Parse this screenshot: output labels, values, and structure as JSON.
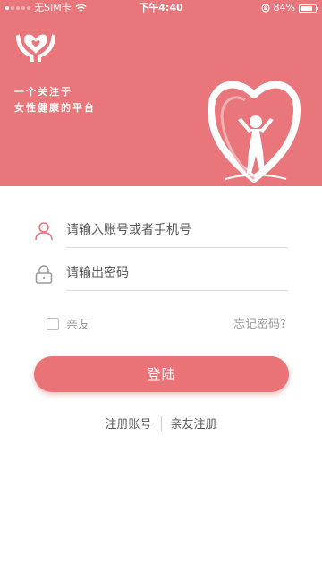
{
  "status_bar": {
    "carrier": "无SIM卡",
    "time": "下午4:40",
    "battery_percent_label": "84%",
    "battery_level": 0.84
  },
  "header": {
    "slogan_line1": "一个关注于",
    "slogan_line2": "女性健康的平台"
  },
  "form": {
    "account_placeholder": "请输入账号或者手机号",
    "password_placeholder": "请输出密码",
    "relative_label": "亲友",
    "forgot_label": "忘记密码?",
    "login_label": "登陆"
  },
  "links": {
    "register_label": "注册账号",
    "relative_register_label": "亲友注册"
  },
  "colors": {
    "brand": "#e9767a",
    "button": "#ea7377"
  },
  "icons": {
    "logo": "hands-heart-logo",
    "emblem": "heart-figure-emblem",
    "account": "user-icon",
    "password": "lock-icon"
  }
}
